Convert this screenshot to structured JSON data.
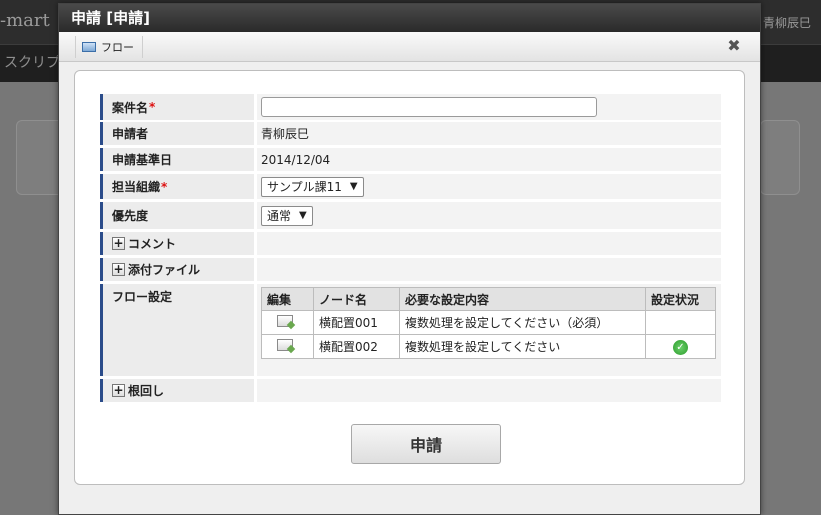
{
  "background": {
    "logo_text": "-mart",
    "user_name": "青柳辰巳",
    "menu_text": "スクリプ"
  },
  "dialog": {
    "title": "申請 [申請]",
    "toolbar_tab": "フロー",
    "close_glyph": "✖"
  },
  "form": {
    "case_name_label": "案件名",
    "case_name_value": "",
    "applicant_label": "申請者",
    "applicant_value": "青柳辰巳",
    "base_date_label": "申請基準日",
    "base_date_value": "2014/12/04",
    "org_label": "担当組織",
    "org_value": "サンプル課11",
    "priority_label": "優先度",
    "priority_value": "通常",
    "comment_label": "コメント",
    "attach_label": "添付ファイル",
    "flow_label": "フロー設定",
    "nemawashi_label": "根回し",
    "required_mark": "*"
  },
  "flow_table": {
    "headers": [
      "編集",
      "ノード名",
      "必要な設定内容",
      "設定状況"
    ],
    "rows": [
      {
        "node": "横配置001",
        "content": "複数処理を設定してください（必須）",
        "status": ""
      },
      {
        "node": "横配置002",
        "content": "複数処理を設定してください",
        "status": "check"
      }
    ]
  },
  "submit_label": "申請",
  "colors": {
    "label_accent": "#2b4c8a",
    "required": "#dd1111",
    "ok_green": "#2a9a2a"
  }
}
